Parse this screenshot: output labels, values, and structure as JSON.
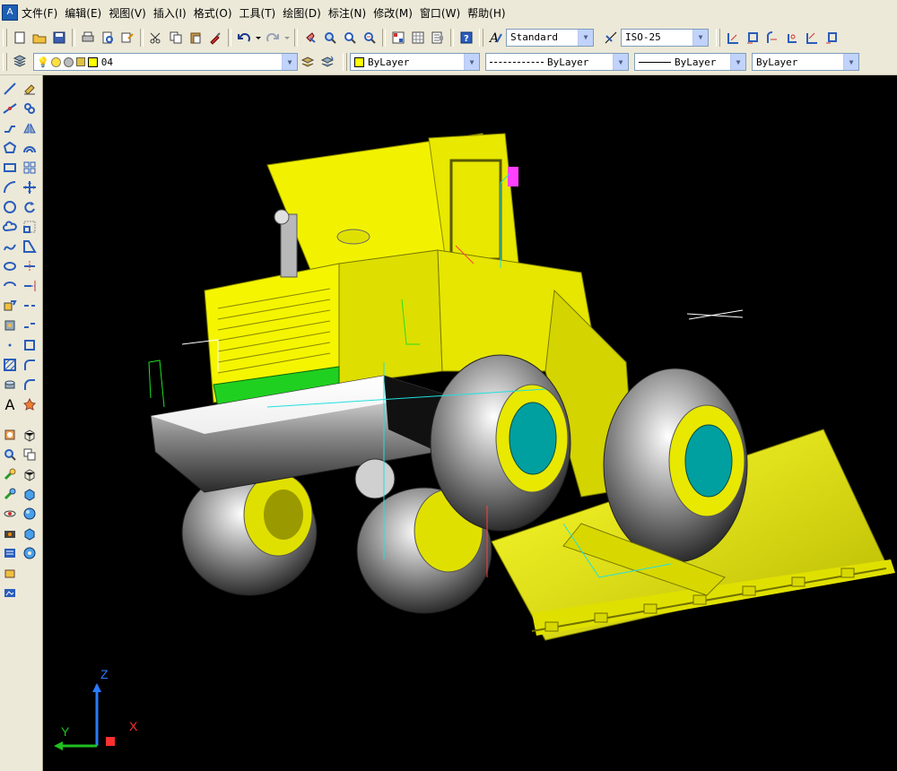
{
  "app": {
    "icon_label": "A"
  },
  "menu": [
    "文件(F)",
    "编辑(E)",
    "视图(V)",
    "插入(I)",
    "格式(O)",
    "工具(T)",
    "绘图(D)",
    "标注(N)",
    "修改(M)",
    "窗口(W)",
    "帮助(H)"
  ],
  "styles": {
    "text_style": "Standard",
    "dim_style": "ISO-25"
  },
  "layer": {
    "name": "04",
    "color": "#ffff00"
  },
  "properties": {
    "color": "ByLayer",
    "linetype": "ByLayer",
    "lineweight": "ByLayer",
    "plotstyle": "ByLayer"
  },
  "text_tool_label": "A",
  "ucs": {
    "x": "X",
    "y": "Y",
    "z": "Z"
  },
  "colors": {
    "model_body": "#ffff00",
    "viewport_bg": "#000000",
    "toolbar_bg": "#ece9d8"
  }
}
